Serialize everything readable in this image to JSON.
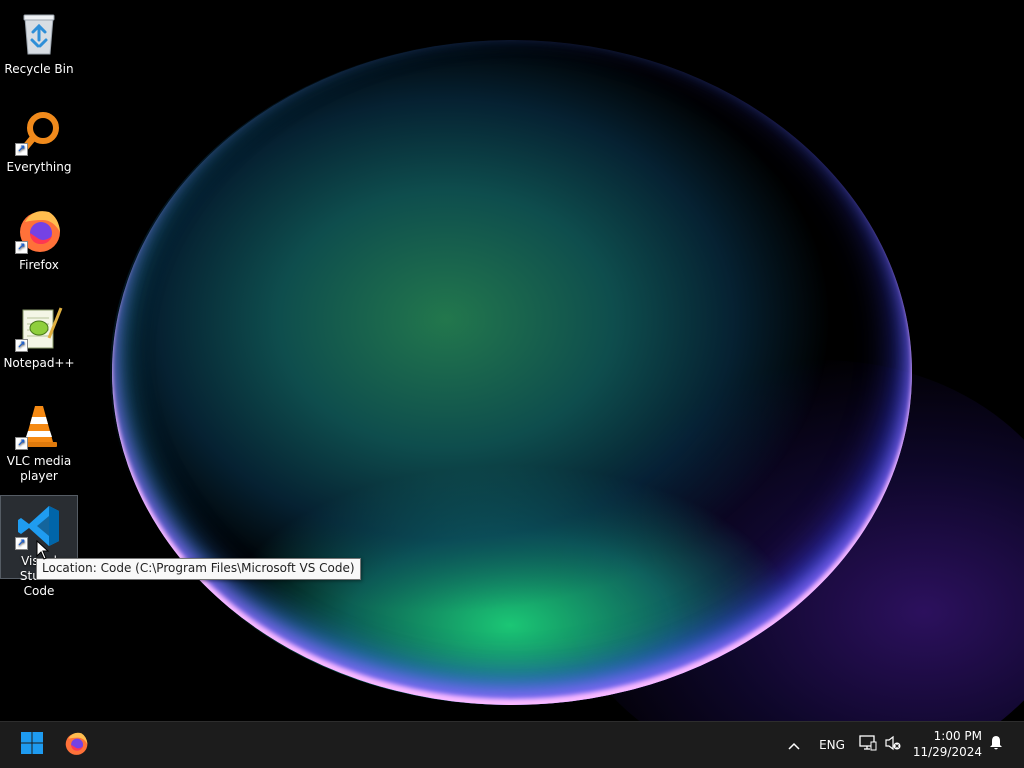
{
  "desktop": {
    "icons": [
      {
        "label": "Recycle Bin",
        "icon": "recycle-bin-icon",
        "shortcut": false
      },
      {
        "label": "Everything",
        "icon": "everything-search-icon",
        "shortcut": true
      },
      {
        "label": "Firefox",
        "icon": "firefox-icon",
        "shortcut": true
      },
      {
        "label": "Notepad++",
        "icon": "notepad-plus-plus-icon",
        "shortcut": true
      },
      {
        "label": "VLC media player",
        "icon": "vlc-cone-icon",
        "shortcut": true
      },
      {
        "label": "Visual Studio Code",
        "icon": "vscode-icon",
        "shortcut": true,
        "selected": true
      }
    ],
    "tooltip": "Location: Code (C:\\Program Files\\Microsoft VS Code)"
  },
  "taskbar": {
    "start_icon": "windows-start-icon",
    "pinned": [
      {
        "name": "Firefox",
        "icon": "firefox-icon"
      }
    ],
    "tray": {
      "overflow_icon": "chevron-up-icon",
      "language": "ENG",
      "network_icon": "network-icon",
      "volume_icon": "volume-muted-icon",
      "time": "1:00 PM",
      "date": "11/29/2024",
      "notification_icon": "bell-icon"
    }
  },
  "colors": {
    "taskbar_bg": "#1c1c1c",
    "windows_blue": "#1e9bf0",
    "selection_bg": "#5a646e"
  }
}
